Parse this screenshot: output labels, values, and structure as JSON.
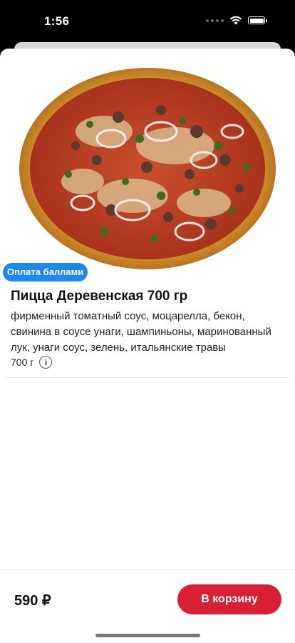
{
  "status_bar": {
    "time": "1:56"
  },
  "product": {
    "badge": "Оплата баллами",
    "title": "Пицца Деревенская 700 гр",
    "description": "фирменный томатный соус,  моцарелла, бекон, свинина в соусе унаги, шампиньоны, маринованный лук, унаги соус, зелень, итальянские травы",
    "weight": "700 г",
    "image_icon": "pizza-image"
  },
  "footer": {
    "price": "590 ₽",
    "cart_button_label": "В корзину"
  },
  "colors": {
    "badge": "#1e88f0",
    "cart_button": "#d81f35"
  }
}
